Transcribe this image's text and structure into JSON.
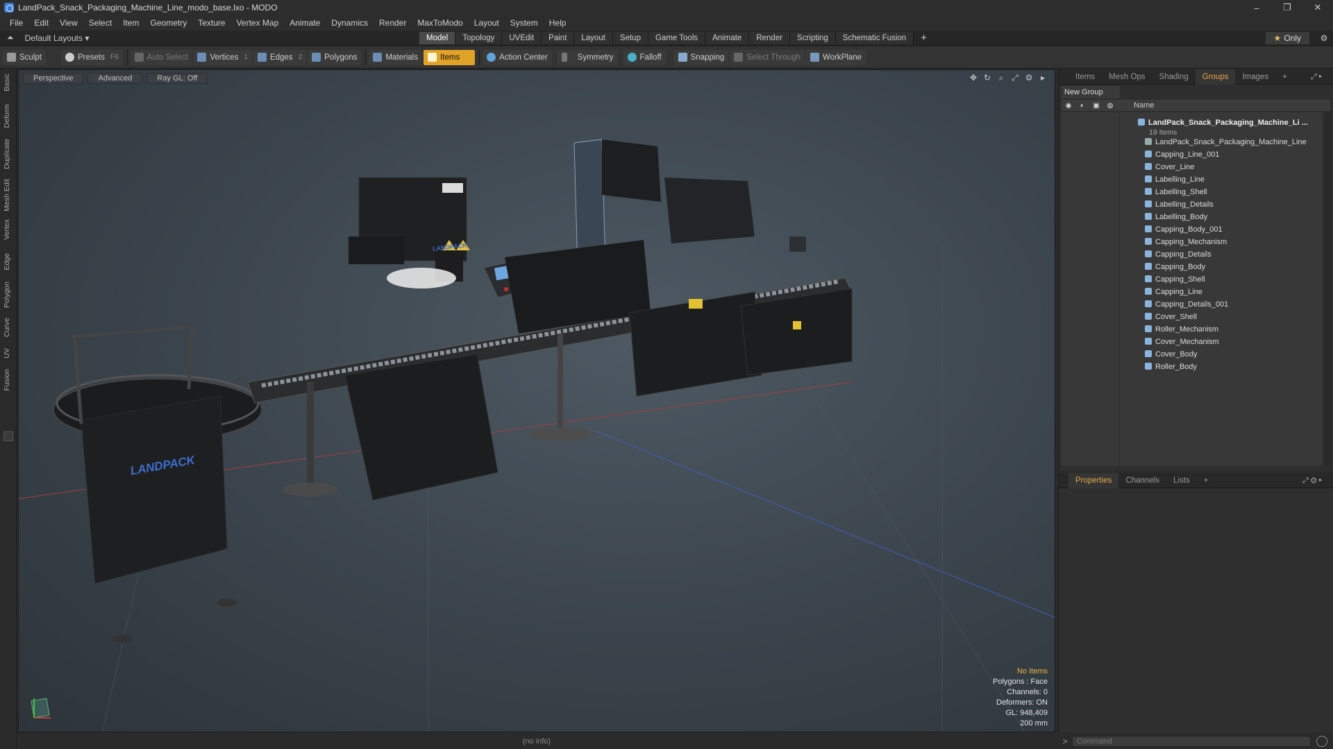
{
  "window": {
    "title": "LandPack_Snack_Packaging_Machine_Line_modo_base.lxo - MODO",
    "controls": [
      "–",
      "❐",
      "✕"
    ]
  },
  "menu": [
    "File",
    "Edit",
    "View",
    "Select",
    "Item",
    "Geometry",
    "Texture",
    "Vertex Map",
    "Animate",
    "Dynamics",
    "Render",
    "MaxToModo",
    "Layout",
    "System",
    "Help"
  ],
  "layoutbar": {
    "layout_label": "Default Layouts ▾",
    "tabs": [
      "Model",
      "Topology",
      "UVEdit",
      "Paint",
      "Layout",
      "Setup",
      "Game Tools",
      "Animate",
      "Render",
      "Scripting",
      "Schematic Fusion"
    ],
    "active_tab": "Model",
    "only_star": "★",
    "only_label": "Only"
  },
  "toolbar": {
    "sculpt": "Sculpt",
    "presets": "Presets",
    "presets_key": "F6",
    "auto_select": "Auto Select",
    "vertices": "Vertices",
    "vertices_key": "1",
    "edges": "Edges",
    "edges_key": "2",
    "polygons": "Polygons",
    "materials": "Materials",
    "items": "Items",
    "action_center": "Action Center",
    "symmetry": "Symmetry",
    "falloff": "Falloff",
    "snapping": "Snapping",
    "select_through": "Select Through",
    "workplane": "WorkPlane"
  },
  "lefttabs": [
    "Basic",
    "Deform",
    "Duplicate",
    "Mesh Edit",
    "Vertex",
    "Edge",
    "Polygon",
    "Curve",
    "UV",
    "Fusion"
  ],
  "viewport": {
    "buttons": [
      "Perspective",
      "Advanced",
      "Ray GL: Off"
    ],
    "info": {
      "no_items": "No Items",
      "polygons": "Polygons : Face",
      "channels": "Channels: 0",
      "deformers": "Deformers: ON",
      "gl": "GL: 948,409",
      "scale": "200 mm"
    },
    "brand_text": "LANDPACK"
  },
  "status": "(no info)",
  "rightpanel": {
    "tabs": [
      "Items",
      "Mesh Ops",
      "Shading",
      "Groups",
      "Images",
      "+"
    ],
    "active_tab": "Groups",
    "new_group": "New Group",
    "col_name": "Name",
    "root": {
      "name": "LandPack_Snack_Packaging_Machine_Li ...",
      "count": "19 Items"
    },
    "items": [
      "LandPack_Snack_Packaging_Machine_Line",
      "Capping_Line_001",
      "Cover_Line",
      "Labelling_Line",
      "Labelling_Shell",
      "Labelling_Details",
      "Labelling_Body",
      "Capping_Body_001",
      "Capping_Mechanism",
      "Capping_Details",
      "Capping_Body",
      "Capping_Shell",
      "Capping_Line",
      "Capping_Details_001",
      "Cover_Shell",
      "Roller_Mechanism",
      "Cover_Mechanism",
      "Cover_Body",
      "Roller_Body"
    ]
  },
  "props": {
    "tabs": [
      "Properties",
      "Channels",
      "Lists",
      "+"
    ],
    "active_tab": "Properties"
  },
  "command": {
    "placeholder": "Command"
  }
}
